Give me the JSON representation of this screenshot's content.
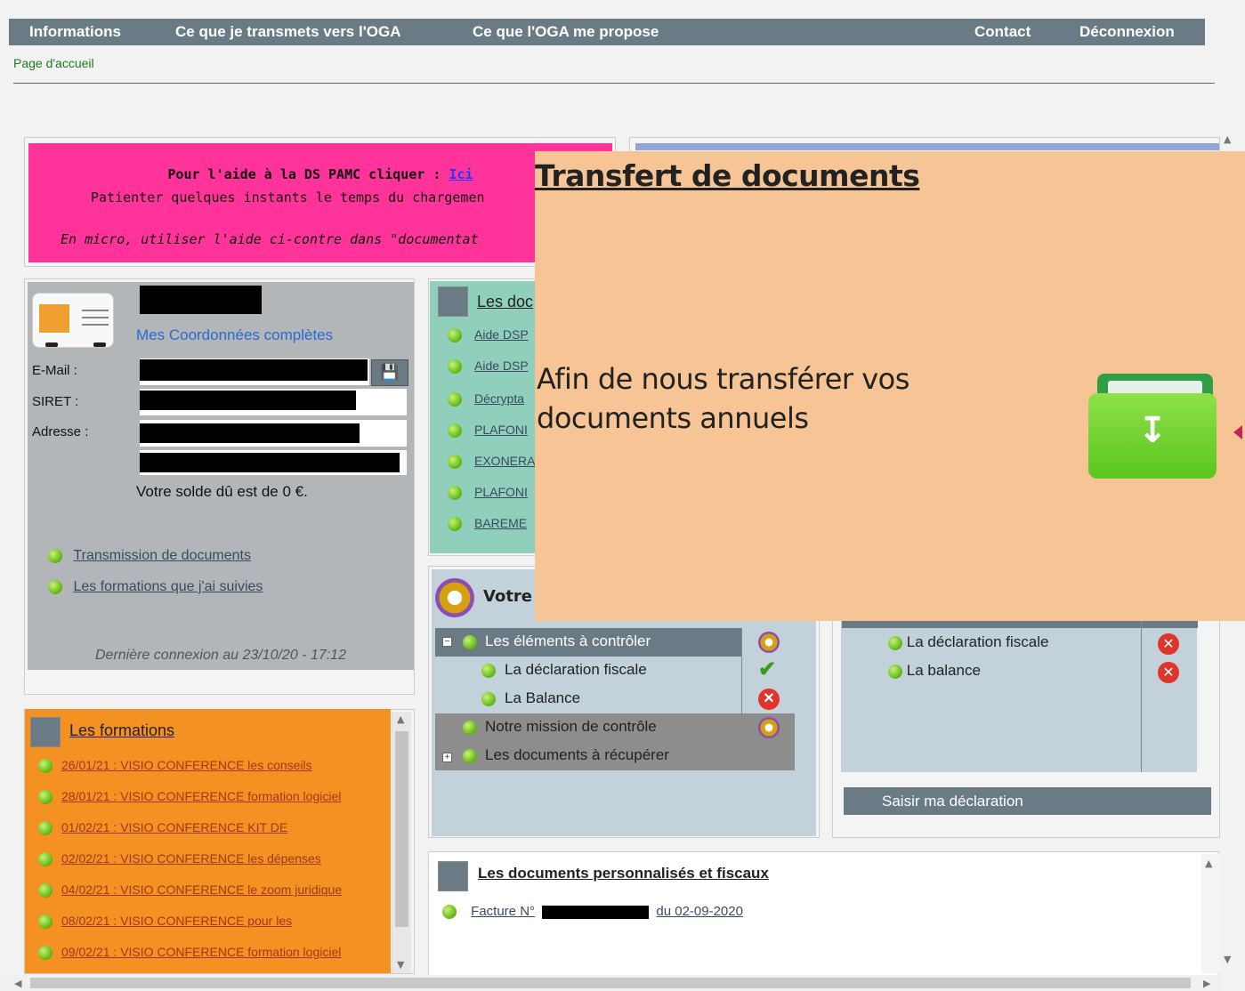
{
  "nav": {
    "informations": "Informations",
    "transmets": "Ce que je transmets vers l'OGA",
    "propose": "Ce que l'OGA me propose",
    "contact": "Contact",
    "deconnexion": "Déconnexion"
  },
  "breadcrumb": "Page d'accueil",
  "banner": {
    "line1_prefix": "Pour l'aide à la DS PAMC cliquer : ",
    "line1_link": "Ici",
    "line2": "Patienter quelques instants le temps du chargemen",
    "line3": "En micro, utiliser l'aide ci-contre dans \"documentat"
  },
  "user": {
    "coord_link": "Mes Coordonnées complètes",
    "email_label": "E-Mail :",
    "siret_label": "SIRET :",
    "adresse_label": "Adresse :",
    "solde": "Votre solde dû est de 0 €.",
    "links": [
      "Transmission de documents",
      "Les formations que j'ai suivies"
    ],
    "last_login": "Dernière connexion au 23/10/20 - 17:12",
    "save_icon": "floppy-disk-icon"
  },
  "formations": {
    "title": "Les formations",
    "items": [
      "26/01/21 : VISIO CONFERENCE les conseils",
      "28/01/21 : VISIO CONFERENCE formation logiciel",
      "01/02/21 : VISIO CONFERENCE KIT DE",
      "02/02/21 : VISIO CONFERENCE les dépenses",
      "04/02/21 : VISIO CONFERENCE le zoom juridique",
      "08/02/21 : VISIO CONFERENCE pour les",
      "09/02/21 : VISIO CONFERENCE formation logiciel"
    ]
  },
  "docs": {
    "title": "Les doc",
    "items": [
      "Aide DSP",
      "Aide DSP",
      "Décrypta",
      "PLAFONI",
      "EXONERA",
      "PLAFONI",
      "BAREME"
    ]
  },
  "controle": {
    "title": "Votre",
    "rows": [
      {
        "label": "Les éléments à contrôler",
        "status": "pending"
      },
      {
        "label": "La déclaration fiscale",
        "status": "ok"
      },
      {
        "label": "La Balance",
        "status": "error"
      },
      {
        "label": "Notre mission de contrôle",
        "status": "pending"
      },
      {
        "label": "Les documents à récupérer",
        "status": ""
      }
    ]
  },
  "declaration": {
    "rows": [
      {
        "label": "La déclaration fiscale",
        "status": "error"
      },
      {
        "label": "La balance",
        "status": "error"
      }
    ],
    "button": "Saisir ma déclaration"
  },
  "personnalises": {
    "title": "Les documents personnalisés et fiscaux",
    "invoice_prefix": "Facture N°",
    "invoice_suffix": "du 02-09-2020"
  },
  "overlay": {
    "title": "Transfert de documents",
    "text": "Afin de nous transférer vos documents annuels",
    "icon": "download-folder-icon"
  },
  "colors": {
    "nav": "#6b7b85",
    "banner": "#ff3399",
    "formations": "#f39122",
    "docs": "#8fcfbc",
    "overlay": "#f7c595"
  }
}
